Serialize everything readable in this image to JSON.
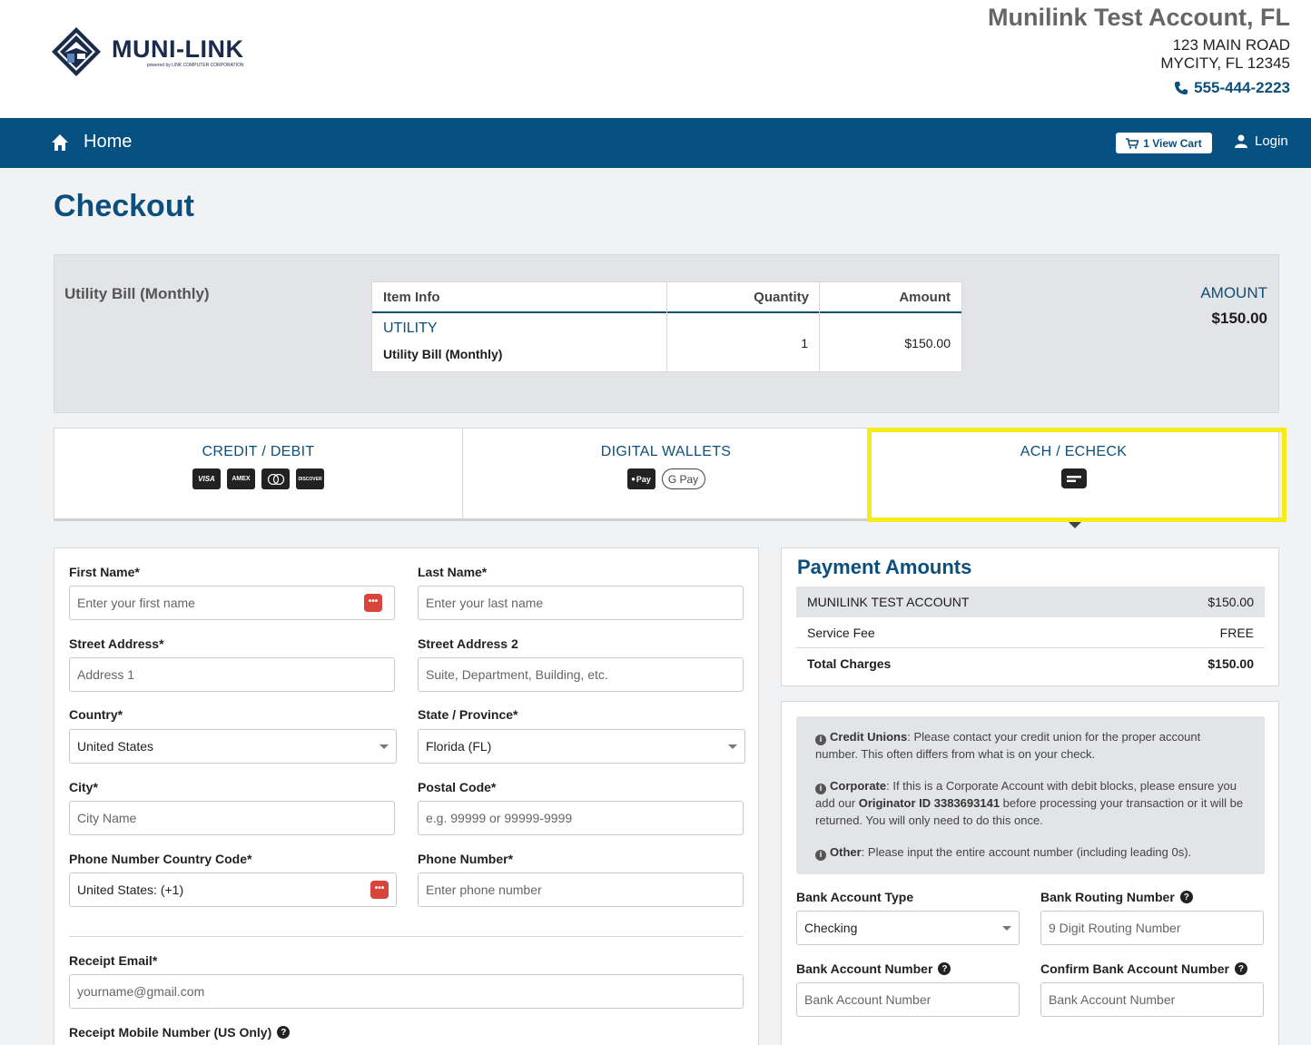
{
  "header": {
    "logo_title": "MUNI-LINK",
    "logo_subtitle": "powered by LINK COMPUTER CORPORATION",
    "account_name": "Munilink Test Account, FL",
    "address_line1": "123 MAIN ROAD",
    "address_line2": "MYCITY, FL 12345",
    "phone": "555-444-2223"
  },
  "nav": {
    "home_label": "Home",
    "cart_label": "1 View Cart",
    "login_label": "Login"
  },
  "page": {
    "title": "Checkout"
  },
  "summary": {
    "label": "Utility Bill (Monthly)",
    "table_headers": {
      "item_info": "Item Info",
      "quantity": "Quantity",
      "amount": "Amount"
    },
    "item": {
      "type": "UTILITY",
      "name": "Utility Bill (Monthly)",
      "quantity": "1",
      "amount": "$150.00"
    },
    "amount_label": "AMOUNT",
    "amount_value": "$150.00"
  },
  "payment_tabs": [
    {
      "label": "CREDIT / DEBIT",
      "icons": [
        "VISA",
        "AMEX",
        "MC",
        "DISCOVER"
      ]
    },
    {
      "label": "DIGITAL WALLETS",
      "icons": [
        "Pay",
        "G Pay"
      ]
    },
    {
      "label": "ACH / ECHECK",
      "icons": [
        "check-icon"
      ],
      "selected": true
    }
  ],
  "form": {
    "first_name_label": "First Name*",
    "first_name_placeholder": "Enter your first name",
    "last_name_label": "Last Name*",
    "last_name_placeholder": "Enter your last name",
    "street1_label": "Street Address*",
    "street1_placeholder": "Address 1",
    "street2_label": "Street Address 2",
    "street2_placeholder": "Suite, Department, Building, etc.",
    "country_label": "Country*",
    "country_value": "United States",
    "state_label": "State / Province*",
    "state_value": "Florida (FL)",
    "city_label": "City*",
    "city_placeholder": "City Name",
    "postal_label": "Postal Code*",
    "postal_placeholder": "e.g. 99999 or 99999-9999",
    "phone_cc_label": "Phone Number Country Code*",
    "phone_cc_value": "United States: (+1)",
    "phone_label": "Phone Number*",
    "phone_placeholder": "Enter phone number",
    "email_label": "Receipt Email*",
    "email_placeholder": "yourname@gmail.com",
    "mobile_label": "Receipt Mobile Number (US Only)"
  },
  "amounts": {
    "title": "Payment Amounts",
    "rows": [
      {
        "label": "MUNILINK TEST ACCOUNT",
        "value": "$150.00"
      },
      {
        "label": "Service Fee",
        "value": "FREE"
      },
      {
        "label": "Total Charges",
        "value": "$150.00"
      }
    ]
  },
  "ach": {
    "notice": {
      "credit_unions_title": "Credit Unions",
      "credit_unions_text": ": Please contact your credit union for the proper account number. This often differs from what is on your check.",
      "corporate_title": "Corporate",
      "corporate_text_1": ": If this is a Corporate Account with debit blocks, please ensure you add our ",
      "originator": "Originator ID 3383693141",
      "corporate_text_2": " before processing your transaction or it will be returned. You will only need to do this once.",
      "other_title": "Other",
      "other_text": ": Please input the entire account number (including leading 0s)."
    },
    "account_type_label": "Bank Account Type",
    "account_type_value": "Checking",
    "routing_label": "Bank Routing Number",
    "routing_placeholder": "9 Digit Routing Number",
    "account_number_label": "Bank Account Number",
    "account_number_placeholder": "Bank Account Number",
    "confirm_label": "Confirm Bank Account Number",
    "confirm_placeholder": "Bank Account Number"
  },
  "colors": {
    "brand": "#065182",
    "accent_text": "#0c4f7c",
    "highlight": "#f7ec1b"
  }
}
